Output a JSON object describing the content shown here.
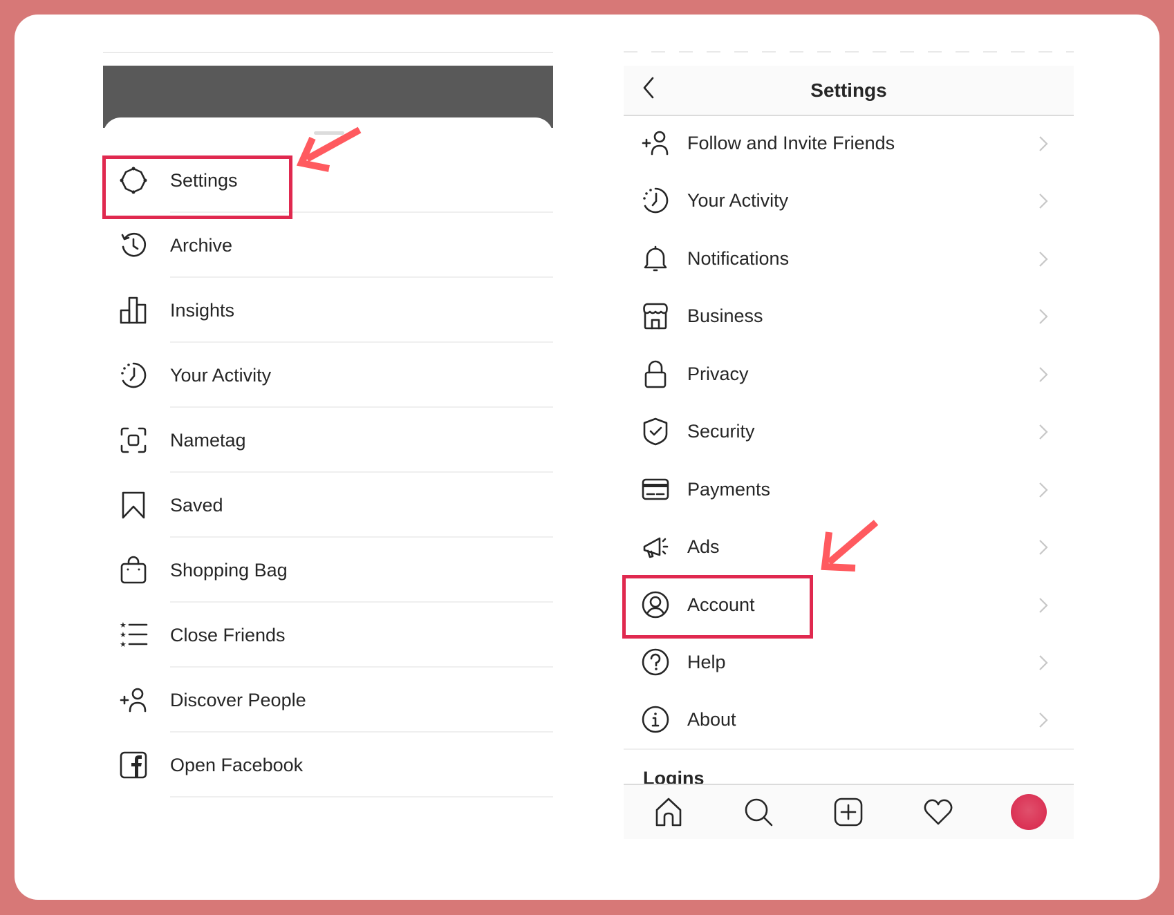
{
  "colors": {
    "frame": "#D77877",
    "highlight": "#E0294F",
    "arrow": "#FF5A5F",
    "avatar": "#D8244A"
  },
  "left_panel": {
    "menu_items": [
      {
        "label": "Settings",
        "icon": "gear-icon",
        "highlighted": true
      },
      {
        "label": "Archive",
        "icon": "archive-clock-icon"
      },
      {
        "label": "Insights",
        "icon": "bar-chart-icon"
      },
      {
        "label": "Your Activity",
        "icon": "activity-clock-icon"
      },
      {
        "label": "Nametag",
        "icon": "nametag-scan-icon"
      },
      {
        "label": "Saved",
        "icon": "bookmark-icon"
      },
      {
        "label": "Shopping Bag",
        "icon": "shopping-bag-icon"
      },
      {
        "label": "Close Friends",
        "icon": "star-list-icon"
      },
      {
        "label": "Discover People",
        "icon": "add-person-icon"
      },
      {
        "label": "Open Facebook",
        "icon": "facebook-icon"
      }
    ]
  },
  "right_panel": {
    "header": {
      "title": "Settings",
      "back_icon": "chevron-left-icon"
    },
    "menu_items": [
      {
        "label": "Follow and Invite Friends",
        "icon": "add-person-icon"
      },
      {
        "label": "Your Activity",
        "icon": "activity-clock-icon"
      },
      {
        "label": "Notifications",
        "icon": "bell-icon"
      },
      {
        "label": "Business",
        "icon": "storefront-icon"
      },
      {
        "label": "Privacy",
        "icon": "lock-icon"
      },
      {
        "label": "Security",
        "icon": "shield-check-icon"
      },
      {
        "label": "Payments",
        "icon": "credit-card-icon"
      },
      {
        "label": "Ads",
        "icon": "megaphone-icon"
      },
      {
        "label": "Account",
        "icon": "account-circle-icon",
        "highlighted": true
      },
      {
        "label": "Help",
        "icon": "help-circle-icon"
      },
      {
        "label": "About",
        "icon": "info-circle-icon"
      }
    ],
    "section_heading": "Logins",
    "bottom_nav": [
      {
        "name": "home",
        "icon": "home-icon"
      },
      {
        "name": "search",
        "icon": "search-icon"
      },
      {
        "name": "new-post",
        "icon": "add-square-icon"
      },
      {
        "name": "activity",
        "icon": "heart-icon"
      },
      {
        "name": "profile",
        "icon": "avatar"
      }
    ]
  }
}
